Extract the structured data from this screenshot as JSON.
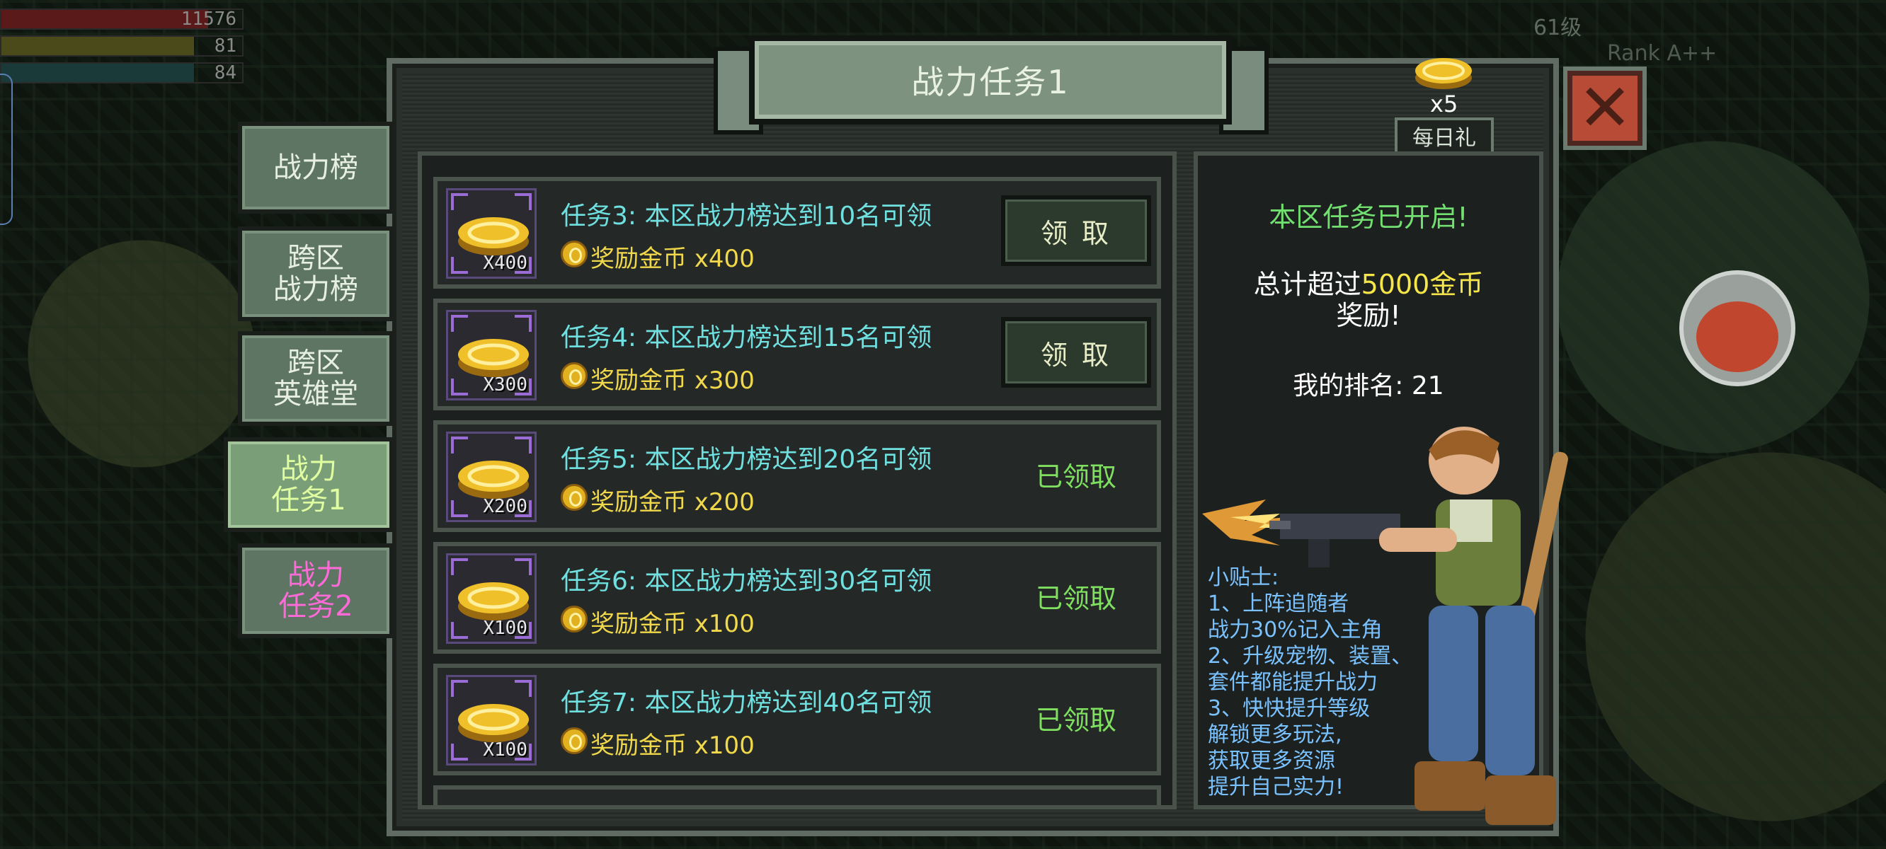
{
  "hud": {
    "hp_value": "11576",
    "mp_value": "81",
    "xp_value": "84",
    "level_text": "61级",
    "rank_text": "Rank A++"
  },
  "title": "战力任务1",
  "daily_gift": {
    "count": "x5",
    "label": "每日礼"
  },
  "close_icon": "close-icon",
  "tabs": [
    {
      "label": "战力榜"
    },
    {
      "label": "跨区\n战力榜"
    },
    {
      "label": "跨区\n英雄堂"
    },
    {
      "label": "战力\n任务1"
    },
    {
      "label": "战力\n任务2"
    }
  ],
  "active_tab": 3,
  "tasks": [
    {
      "title": "任务3: 本区战力榜达到10名可领",
      "reward": "奖励金币 x400",
      "qty": "X400",
      "action": "领 取",
      "claimed": false
    },
    {
      "title": "任务4: 本区战力榜达到15名可领",
      "reward": "奖励金币 x300",
      "qty": "X300",
      "action": "领 取",
      "claimed": false
    },
    {
      "title": "任务5: 本区战力榜达到20名可领",
      "reward": "奖励金币 x200",
      "qty": "X200",
      "action": "已领取",
      "claimed": true
    },
    {
      "title": "任务6: 本区战力榜达到30名可领",
      "reward": "奖励金币 x100",
      "qty": "X100",
      "action": "已领取",
      "claimed": true
    },
    {
      "title": "任务7: 本区战力榜达到40名可领",
      "reward": "奖励金币 x100",
      "qty": "X100",
      "action": "已领取",
      "claimed": true
    }
  ],
  "info": {
    "status": "本区任务已开启!",
    "total_prefix": "总计超过",
    "total_highlight": "5000金币",
    "total_suffix": "奖励!",
    "rank": "我的排名: 21"
  },
  "tips": [
    "小贴士:",
    "1、上阵追随者",
    "战力30%记入主角",
    "2、升级宠物、装置、",
    "套件都能提升战力",
    "3、快快提升等级",
    "解锁更多玩法,",
    "获取更多资源",
    "提升自己实力!"
  ],
  "colors": {
    "task_title": "#6fe0e0",
    "reward_text": "#f1d84a",
    "claimed_text": "#7fe060",
    "status_text": "#72e070",
    "tips_text": "#7ac2ff",
    "highlight": "#f6e64a",
    "close_bg": "#b84b35"
  }
}
